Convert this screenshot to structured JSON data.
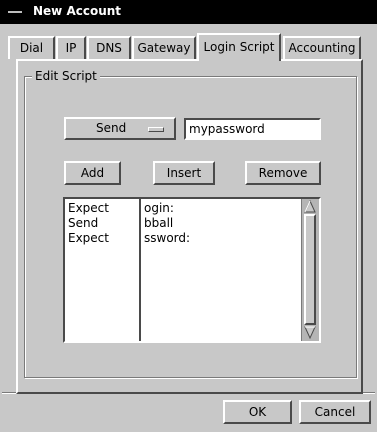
{
  "window": {
    "title": "New Account"
  },
  "tabs": [
    {
      "label": "Dial",
      "active": false
    },
    {
      "label": "IP",
      "active": false
    },
    {
      "label": "DNS",
      "active": false
    },
    {
      "label": "Gateway",
      "active": false
    },
    {
      "label": "Login Script",
      "active": true
    },
    {
      "label": "Accounting",
      "active": false
    }
  ],
  "edit_script": {
    "group_label": "Edit Script",
    "action_select": {
      "value": "Send"
    },
    "argument_input": {
      "value": "mypassword"
    },
    "buttons": {
      "add": "Add",
      "insert": "Insert",
      "remove": "Remove"
    },
    "rows": [
      {
        "action": "Expect",
        "argument": "ogin:"
      },
      {
        "action": "Send",
        "argument": "bball"
      },
      {
        "action": "Expect",
        "argument": "ssword:"
      }
    ]
  },
  "dialog_buttons": {
    "ok": "OK",
    "cancel": "Cancel"
  },
  "icons": {
    "window_menu": "window-menu-icon",
    "option_indicator": "option-menu-indicator-icon",
    "scroll_up": "scroll-up-arrow-icon",
    "scroll_down": "scroll-down-arrow-icon"
  }
}
